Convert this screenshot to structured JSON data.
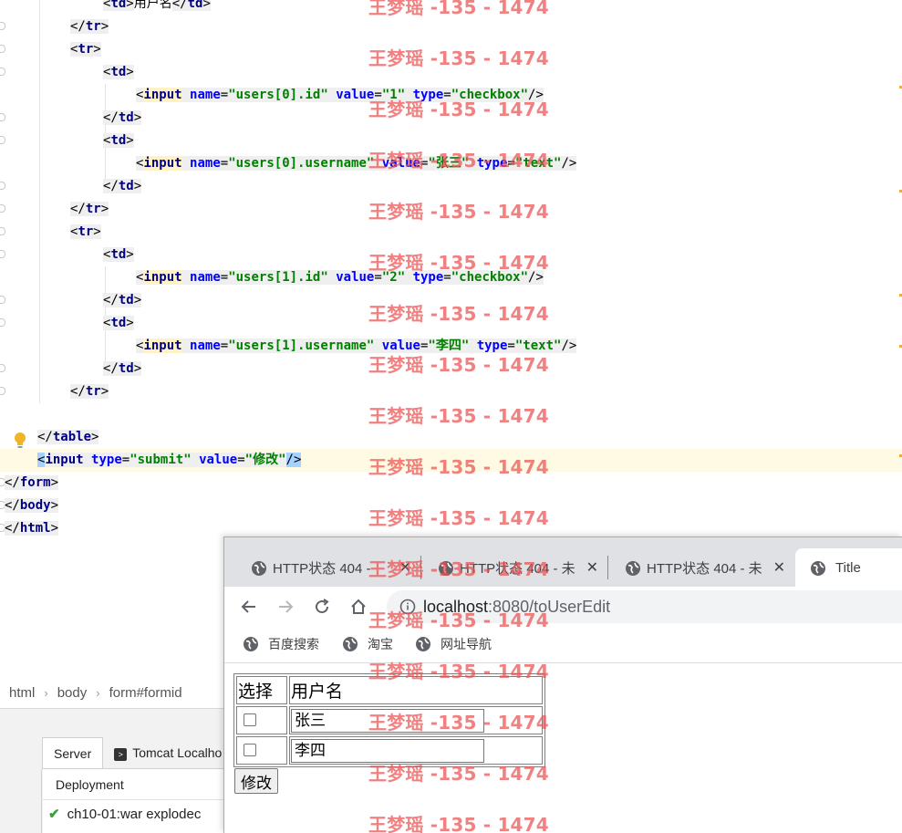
{
  "editor": {
    "l0_text": "用户名",
    "l3_name": "users[0].id",
    "l3_value": "1",
    "l3_type": "checkbox",
    "l6_name": "users[0].username",
    "l6_value": "张三",
    "l6_type": "text",
    "l11_name": "users[1].id",
    "l11_value": "2",
    "l11_type": "checkbox",
    "l14_name": "users[1].username",
    "l14_value": "李四",
    "l14_type": "text",
    "submit_type": "submit",
    "submit_value": "修改"
  },
  "breadcrumb": [
    "html",
    "body",
    "form#formid"
  ],
  "services": {
    "tab_server": "Server",
    "tab_tomcat": "Tomcat Localho",
    "deployment_header": "Deployment",
    "deployment_item": "ch10-01:war explodec"
  },
  "browser": {
    "tabs": [
      {
        "title": "HTTP状态 404 -"
      },
      {
        "title": "HTTP状态 404 - 未"
      },
      {
        "title": "HTTP状态 404 - 未"
      },
      {
        "title": "Title"
      }
    ],
    "url_host": "localhost",
    "url_rest": ":8080/toUserEdit",
    "bookmarks": [
      "百度搜索",
      "淘宝",
      "网址导航"
    ],
    "table": {
      "headers": [
        "选择",
        "用户名"
      ],
      "rows": [
        {
          "username": "张三"
        },
        {
          "username": "李四"
        }
      ]
    },
    "submit_label": "修改"
  },
  "watermark": "王梦瑶 -135 - 1474",
  "colors": {
    "tag": "#000080",
    "attribute": "#0000ff",
    "value": "#008000",
    "watermark": "#ec5050",
    "current_line": "#fffae3"
  }
}
